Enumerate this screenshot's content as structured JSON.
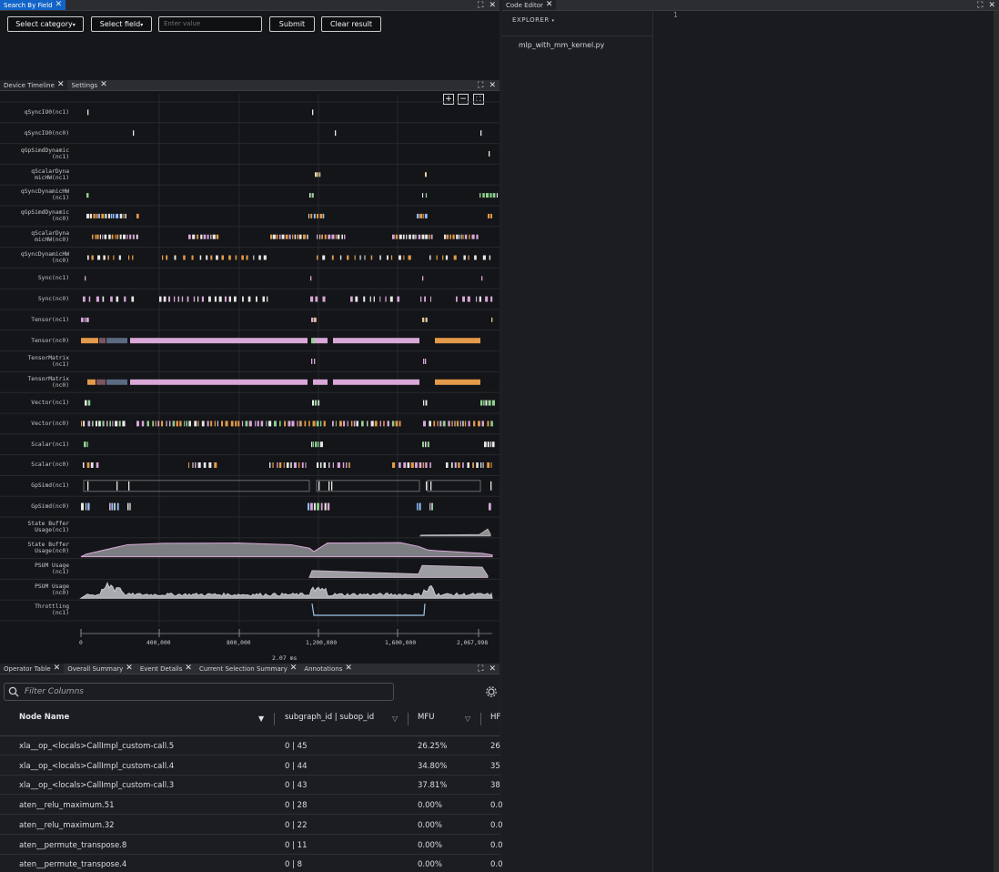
{
  "search": {
    "tab_label": "Search By Field",
    "category_label": "Select category",
    "field_label": "Select field",
    "value_placeholder": "Enter value",
    "submit_label": "Submit",
    "clear_label": "Clear result"
  },
  "timeline": {
    "tabs": [
      "Device Timeline",
      "Settings"
    ],
    "tracks": [
      [
        "qSyncIO0(nc1)"
      ],
      [
        "qSyncIO0(nc0)"
      ],
      [
        "qGpSimdDynamic",
        "(nc1)"
      ],
      [
        "qScalarDyna",
        "micHW(nc1)"
      ],
      [
        "qSyncDynamicHW",
        "(nc1)"
      ],
      [
        "qGpSimdDynamic",
        "(nc0)"
      ],
      [
        "qScalarDyna",
        "micHW(nc0)"
      ],
      [
        "qSyncDynamicHW",
        "(nc0)"
      ],
      [
        "Sync(nc1)"
      ],
      [
        "Sync(nc0)"
      ],
      [
        "Tensor(nc1)"
      ],
      [
        "Tensor(nc0)"
      ],
      [
        "TensorMatrix",
        "(nc1)"
      ],
      [
        "TensorMatrix",
        "(nc0)"
      ],
      [
        "Vector(nc1)"
      ],
      [
        "Vector(nc0)"
      ],
      [
        "Scalar(nc1)"
      ],
      [
        "Scalar(nc0)"
      ],
      [
        "GpSimd(nc1)"
      ],
      [
        "GpSimd(nc0)"
      ],
      [
        "State Buffer",
        "Usage(nc1)"
      ],
      [
        "State Buffer",
        "Usage(nc0)"
      ],
      [
        "PSUM Usage",
        "(nc1)"
      ],
      [
        "PSUM Usage",
        "(nc0)"
      ],
      [
        "Throttling",
        "(nc1)"
      ]
    ],
    "axis_ticks": [
      "0",
      "400,000",
      "800,000",
      "1,200,000",
      "1,600,000",
      "2,067,998"
    ],
    "duration_label": "2.07 ms",
    "zoom_in": "+",
    "zoom_out": "−"
  },
  "operator_table": {
    "tabs": [
      "Operator Table",
      "Overall Summary",
      "Event Details",
      "Current Selection Summary",
      "Annotations"
    ],
    "filter_placeholder": "Filter Columns",
    "headers": [
      "Node Name",
      "subgraph_id | subop_id",
      "MFU",
      "HF"
    ],
    "rows": [
      [
        "xla__op_<locals>CallImpl_custom-call.5",
        "0 | 45",
        "26.25%",
        "26"
      ],
      [
        "xla__op_<locals>CallImpl_custom-call.4",
        "0 | 44",
        "34.80%",
        "35"
      ],
      [
        "xla__op_<locals>CallImpl_custom-call.3",
        "0 | 43",
        "37.81%",
        "38"
      ],
      [
        "aten__relu_maximum.51",
        "0 | 28",
        "0.00%",
        "0.0"
      ],
      [
        "aten__relu_maximum.32",
        "0 | 22",
        "0.00%",
        "0.0"
      ],
      [
        "aten__permute_transpose.8",
        "0 | 11",
        "0.00%",
        "0.0"
      ],
      [
        "aten__permute_transpose.4",
        "0 | 8",
        "0.00%",
        "0.0"
      ]
    ]
  },
  "editor": {
    "tab_label": "Code Editor",
    "explorer_title": "EXPLORER",
    "files": [
      "mlp_with_mm_kernel.py"
    ],
    "line_number": "1"
  },
  "colors": {
    "accent_blue": "#1364c8",
    "pink": "#d9a8d9",
    "orange": "#e39a4a",
    "green": "#8fd18f",
    "white": "#e8e8e8"
  }
}
